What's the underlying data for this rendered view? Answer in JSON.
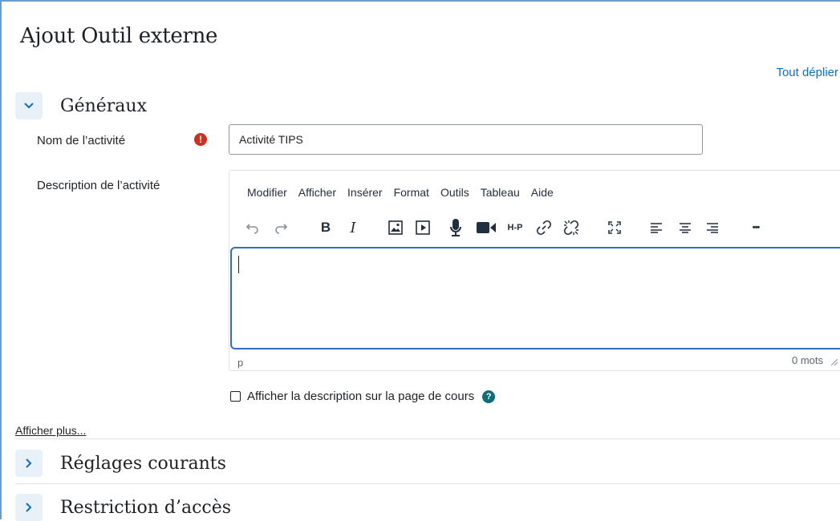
{
  "page": {
    "title": "Ajout Outil externe",
    "expand_all": "Tout déplier"
  },
  "sections": {
    "general": "Généraux",
    "common": "Réglages courants",
    "restrictions": "Restriction d’accès"
  },
  "form": {
    "name_label": "Nom de l’activité",
    "name_value": "Activité TIPS",
    "description_label": "Description de l’activité",
    "show_description_label": "Afficher la description sur la page de cours",
    "show_more": "Afficher plus..."
  },
  "editor": {
    "menu": [
      "Modifier",
      "Afficher",
      "Insérer",
      "Format",
      "Outils",
      "Tableau",
      "Aide"
    ],
    "toolbar_icons": [
      "undo-icon",
      "redo-icon",
      "bold-icon",
      "italic-icon",
      "image-icon",
      "media-icon",
      "microphone-icon",
      "video-camera-icon",
      "h5p-icon",
      "link-icon",
      "unlink-icon",
      "fullscreen-icon",
      "align-left-icon",
      "align-center-icon",
      "align-right-icon",
      "more-icon"
    ],
    "bold_glyph": "B",
    "italic_glyph": "I",
    "h5p_glyph": "H-P",
    "more_glyph": "•••",
    "status_path": "p",
    "word_count": "0 mots"
  },
  "colors": {
    "link": "#0f6cbf",
    "required": "#ca3120",
    "help": "#0f6d7a",
    "focus_border": "#2f6fbf"
  }
}
